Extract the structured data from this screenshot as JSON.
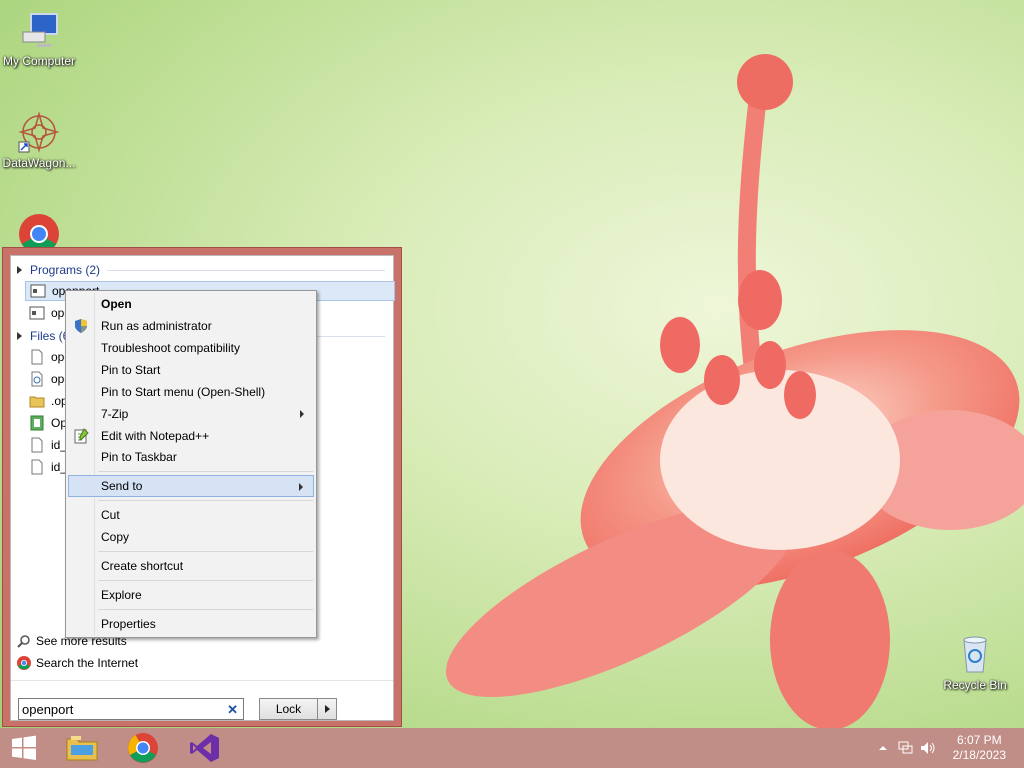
{
  "desktop": {
    "icons": [
      {
        "label": "My Computer",
        "icon": "computer-icon"
      },
      {
        "label": "DataWagon...",
        "icon": "datawagon-shortcut-icon"
      },
      {
        "label": "",
        "icon": "chrome-icon"
      },
      {
        "label": "Recycle Bin",
        "icon": "recycle-bin-icon"
      }
    ]
  },
  "start_menu": {
    "programs_header": "Programs (2)",
    "programs": [
      {
        "label": "openport",
        "icon": "program-icon"
      },
      {
        "label": "ope",
        "icon": "program-icon"
      }
    ],
    "files_header": "Files (6",
    "files": [
      {
        "label": "ope",
        "icon": "file-icon"
      },
      {
        "label": "ope",
        "icon": "script-file-icon"
      },
      {
        "label": ".op",
        "icon": "folder-icon"
      },
      {
        "label": "Op",
        "icon": "document-icon"
      },
      {
        "label": "id_",
        "icon": "file-icon"
      },
      {
        "label": "id_",
        "icon": "file-icon"
      }
    ],
    "see_more": "See more results",
    "search_internet": "Search the Internet",
    "search": {
      "value": "openport",
      "clear": "✕"
    },
    "lock_label": "Lock"
  },
  "context_menu": {
    "items": [
      {
        "label": "Open",
        "bold": true
      },
      {
        "label": "Run as administrator",
        "icon": "uac-shield-icon"
      },
      {
        "label": "Troubleshoot compatibility"
      },
      {
        "label": "Pin to Start"
      },
      {
        "label": "Pin to Start menu (Open-Shell)"
      },
      {
        "label": "7-Zip",
        "submenu": true
      },
      {
        "label": "Edit with Notepad++",
        "icon": "notepadpp-icon"
      },
      {
        "label": "Pin to Taskbar"
      },
      {
        "label": "Send to",
        "submenu": true,
        "highlighted": true
      },
      {
        "label": "Cut"
      },
      {
        "label": "Copy"
      },
      {
        "label": "Create shortcut"
      },
      {
        "label": "Explore"
      },
      {
        "label": "Properties"
      }
    ]
  },
  "taskbar": {
    "pinned": [
      "windows-start-icon",
      "file-explorer-icon",
      "chrome-icon",
      "visual-studio-icon"
    ],
    "time": "6:07 PM",
    "date": "2/18/2023"
  }
}
